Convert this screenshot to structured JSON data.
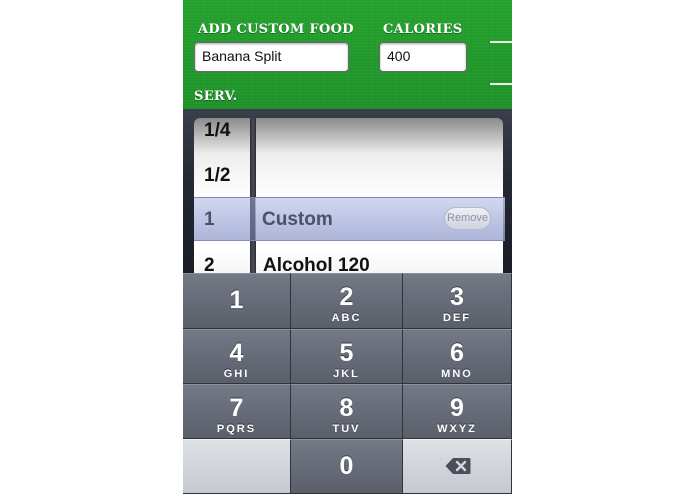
{
  "header": {
    "add_custom_food_label": "ADD CUSTOM FOOD",
    "food_name_value": "Banana Split",
    "calories_label": "CALORIES",
    "calories_value": "400",
    "serving_label": "SERV."
  },
  "picker": {
    "left_column": [
      "1/4",
      "1/2",
      "1",
      "2"
    ],
    "right_column": [
      "",
      "",
      "Custom",
      "Alcohol 120"
    ],
    "selected_serving": "1",
    "selected_food": "Custom",
    "remove_label": "Remove"
  },
  "keypad": {
    "keys": [
      {
        "digit": "1",
        "letters": ""
      },
      {
        "digit": "2",
        "letters": "ABC"
      },
      {
        "digit": "3",
        "letters": "DEF"
      },
      {
        "digit": "4",
        "letters": "GHI"
      },
      {
        "digit": "5",
        "letters": "JKL"
      },
      {
        "digit": "6",
        "letters": "MNO"
      },
      {
        "digit": "7",
        "letters": "PQRS"
      },
      {
        "digit": "8",
        "letters": "TUV"
      },
      {
        "digit": "9",
        "letters": "WXYZ"
      },
      {
        "digit": "0",
        "letters": ""
      }
    ],
    "delete_icon": "backspace-icon"
  },
  "colors": {
    "header_green": "#219a2a",
    "key_dark": "#5a5f6a",
    "key_light": "#c5c9d0",
    "selection_tint": "#b4bce4"
  }
}
